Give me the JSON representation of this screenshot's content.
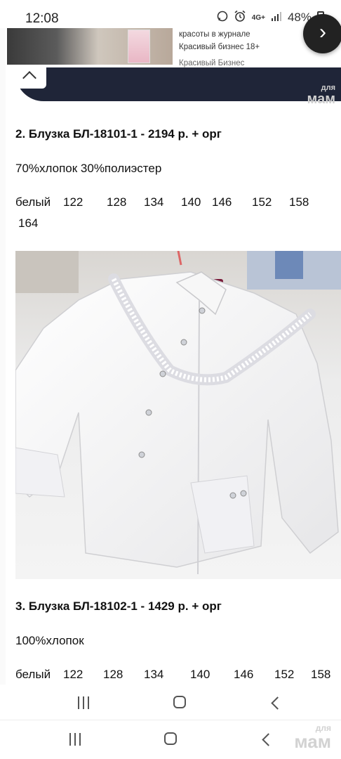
{
  "status_bar": {
    "time": "12:08",
    "network": "4G+",
    "battery": "48%",
    "icons": [
      "whatsapp-icon",
      "alarm-icon",
      "signal-icon",
      "battery-icon"
    ]
  },
  "ad": {
    "text_line1": "красоты в журнале",
    "text_line2": "Красивый бизнес 18+",
    "source": "Красивый Бизнес",
    "next_glyph": "›"
  },
  "watermark": {
    "line1": "для",
    "line2": "мам"
  },
  "products": [
    {
      "title": "2. Блузка БЛ-18101-1 - 2194 р. + орг",
      "material": "70%хлопок 30%полиэстер",
      "color": "белый",
      "sizes": [
        "122",
        "128",
        "134",
        "140",
        "146",
        "152",
        "158",
        "164"
      ]
    },
    {
      "title": "3. Блузка БЛ-18102-1 - 1429 р. + орг",
      "material": "100%хлопок",
      "color": "белый",
      "sizes": [
        "122",
        "128",
        "134",
        "140",
        "146",
        "152",
        "158"
      ]
    }
  ],
  "colors": {
    "dark_fabric": "#1f2538",
    "blouse": "#ffffff",
    "background": "#ffffff"
  }
}
